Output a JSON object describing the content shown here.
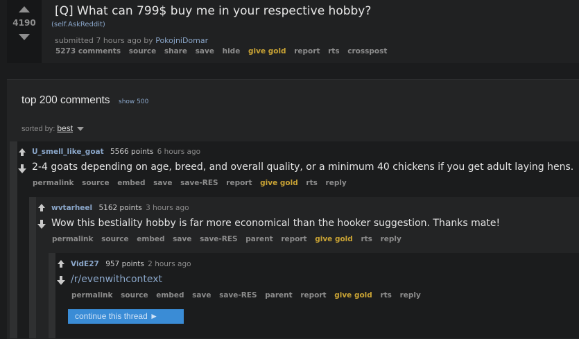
{
  "post": {
    "score": "4190",
    "title": "[Q] What can 799$ buy me in your respective hobby?",
    "domain": "(self.AskReddit)",
    "submitted_prefix": "submitted 7 hours ago by",
    "author": "PokojniDomar",
    "actions": [
      "5273 comments",
      "source",
      "share",
      "save",
      "hide",
      "give gold",
      "report",
      "rts",
      "crosspost"
    ]
  },
  "comments_header": {
    "title": "top 200 comments",
    "show_more": "show 500",
    "sorted_label": "sorted by:",
    "sort_value": "best"
  },
  "comments": [
    {
      "author": "U_smell_like_goat",
      "points": "5566 points",
      "time": "6 hours ago",
      "text": "2-4 goats depending on age, breed, and overall quality, or a minimum 40 chickens if you get adult laying hens.",
      "actions": [
        "permalink",
        "source",
        "embed",
        "save",
        "save-RES",
        "report",
        "give gold",
        "rts",
        "reply"
      ]
    },
    {
      "author": "wvtarheel",
      "points": "5162 points",
      "time": "3 hours ago",
      "text": "Wow this bestiality hobby is far more economical than the hooker suggestion. Thanks mate!",
      "actions": [
        "permalink",
        "source",
        "embed",
        "save",
        "save-RES",
        "parent",
        "report",
        "give gold",
        "rts",
        "reply"
      ]
    },
    {
      "author": "VidE27",
      "points": "957 points",
      "time": "2 hours ago",
      "text": "/r/evenwithcontext",
      "actions": [
        "permalink",
        "source",
        "embed",
        "save",
        "save-RES",
        "parent",
        "report",
        "give gold",
        "rts",
        "reply"
      ]
    }
  ],
  "continue_thread": "continue this thread ►",
  "colors": {
    "background": "#1b1c1d",
    "link": "#8aa6c9",
    "gold": "#c9a334",
    "button": "#3a8cd6"
  }
}
